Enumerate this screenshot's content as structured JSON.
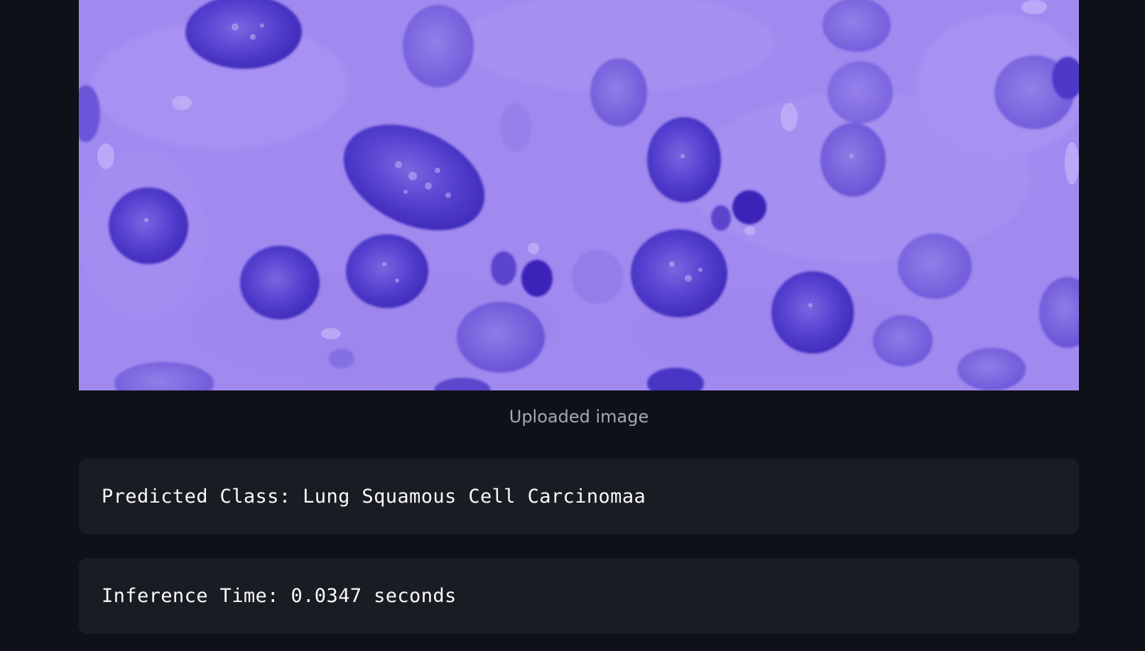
{
  "image": {
    "caption": "Uploaded image",
    "subject": "histology-micrograph"
  },
  "results": {
    "predicted_class": "Predicted Class: Lung Squamous Cell Carcinomaa",
    "inference_time": "Inference Time: 0.0347 seconds"
  },
  "colors": {
    "background": "#0e1117",
    "code_block_bg": "#1a1c24",
    "code_text": "#fafafa",
    "caption_text": "#a3a8b8",
    "tissue_base": "#9f88f0",
    "nucleus": "#4a34c8"
  }
}
